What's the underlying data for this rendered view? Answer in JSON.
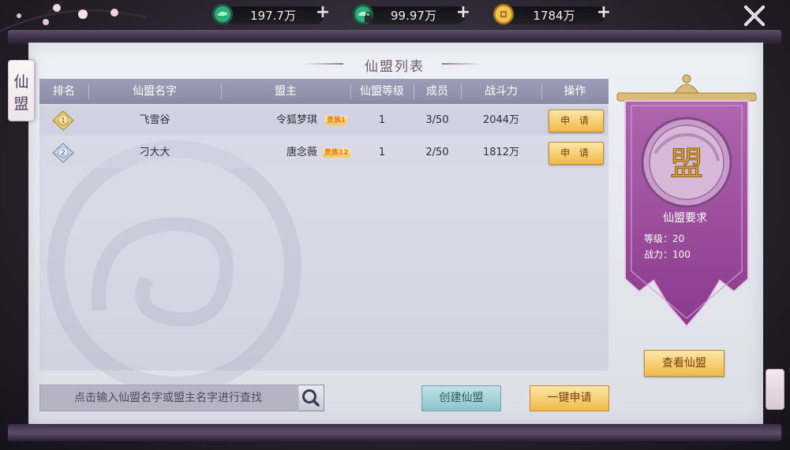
{
  "resources": [
    {
      "icon": "jade-icon",
      "value": "197.7万"
    },
    {
      "icon": "bound-jade-icon",
      "value": "99.97万"
    },
    {
      "icon": "copper-coin-icon",
      "value": "1784万"
    }
  ],
  "side_tab": {
    "char1": "仙",
    "char2": "盟"
  },
  "panel_title": "仙盟列表",
  "table": {
    "headers": [
      "排名",
      "仙盟名字",
      "盟主",
      "仙盟等级",
      "成员",
      "战斗力",
      "操作"
    ],
    "rows": [
      {
        "rank": "1",
        "name": "飞雪谷",
        "leader": "令狐梦琪",
        "vip": "贵族1",
        "level": "1",
        "members": "3/50",
        "power": "2044万",
        "action": "申 请"
      },
      {
        "rank": "2",
        "name": "刁大大",
        "leader": "唐念薇",
        "vip": "贵族12",
        "level": "1",
        "members": "2/50",
        "power": "1812万",
        "action": "申 请"
      }
    ]
  },
  "search": {
    "placeholder": "点击输入仙盟名字或盟主名字进行查找"
  },
  "buttons": {
    "create": "创建仙盟",
    "one_click_apply": "一键申请",
    "view": "查看仙盟"
  },
  "banner": {
    "emblem": "盟",
    "title": "仙盟要求",
    "level_req": "等级：20",
    "power_req": "战力：100"
  },
  "colors": {
    "accent_gold": "#f0b94a",
    "banner_purple": "#a24aa0",
    "header": "#9492ae"
  }
}
